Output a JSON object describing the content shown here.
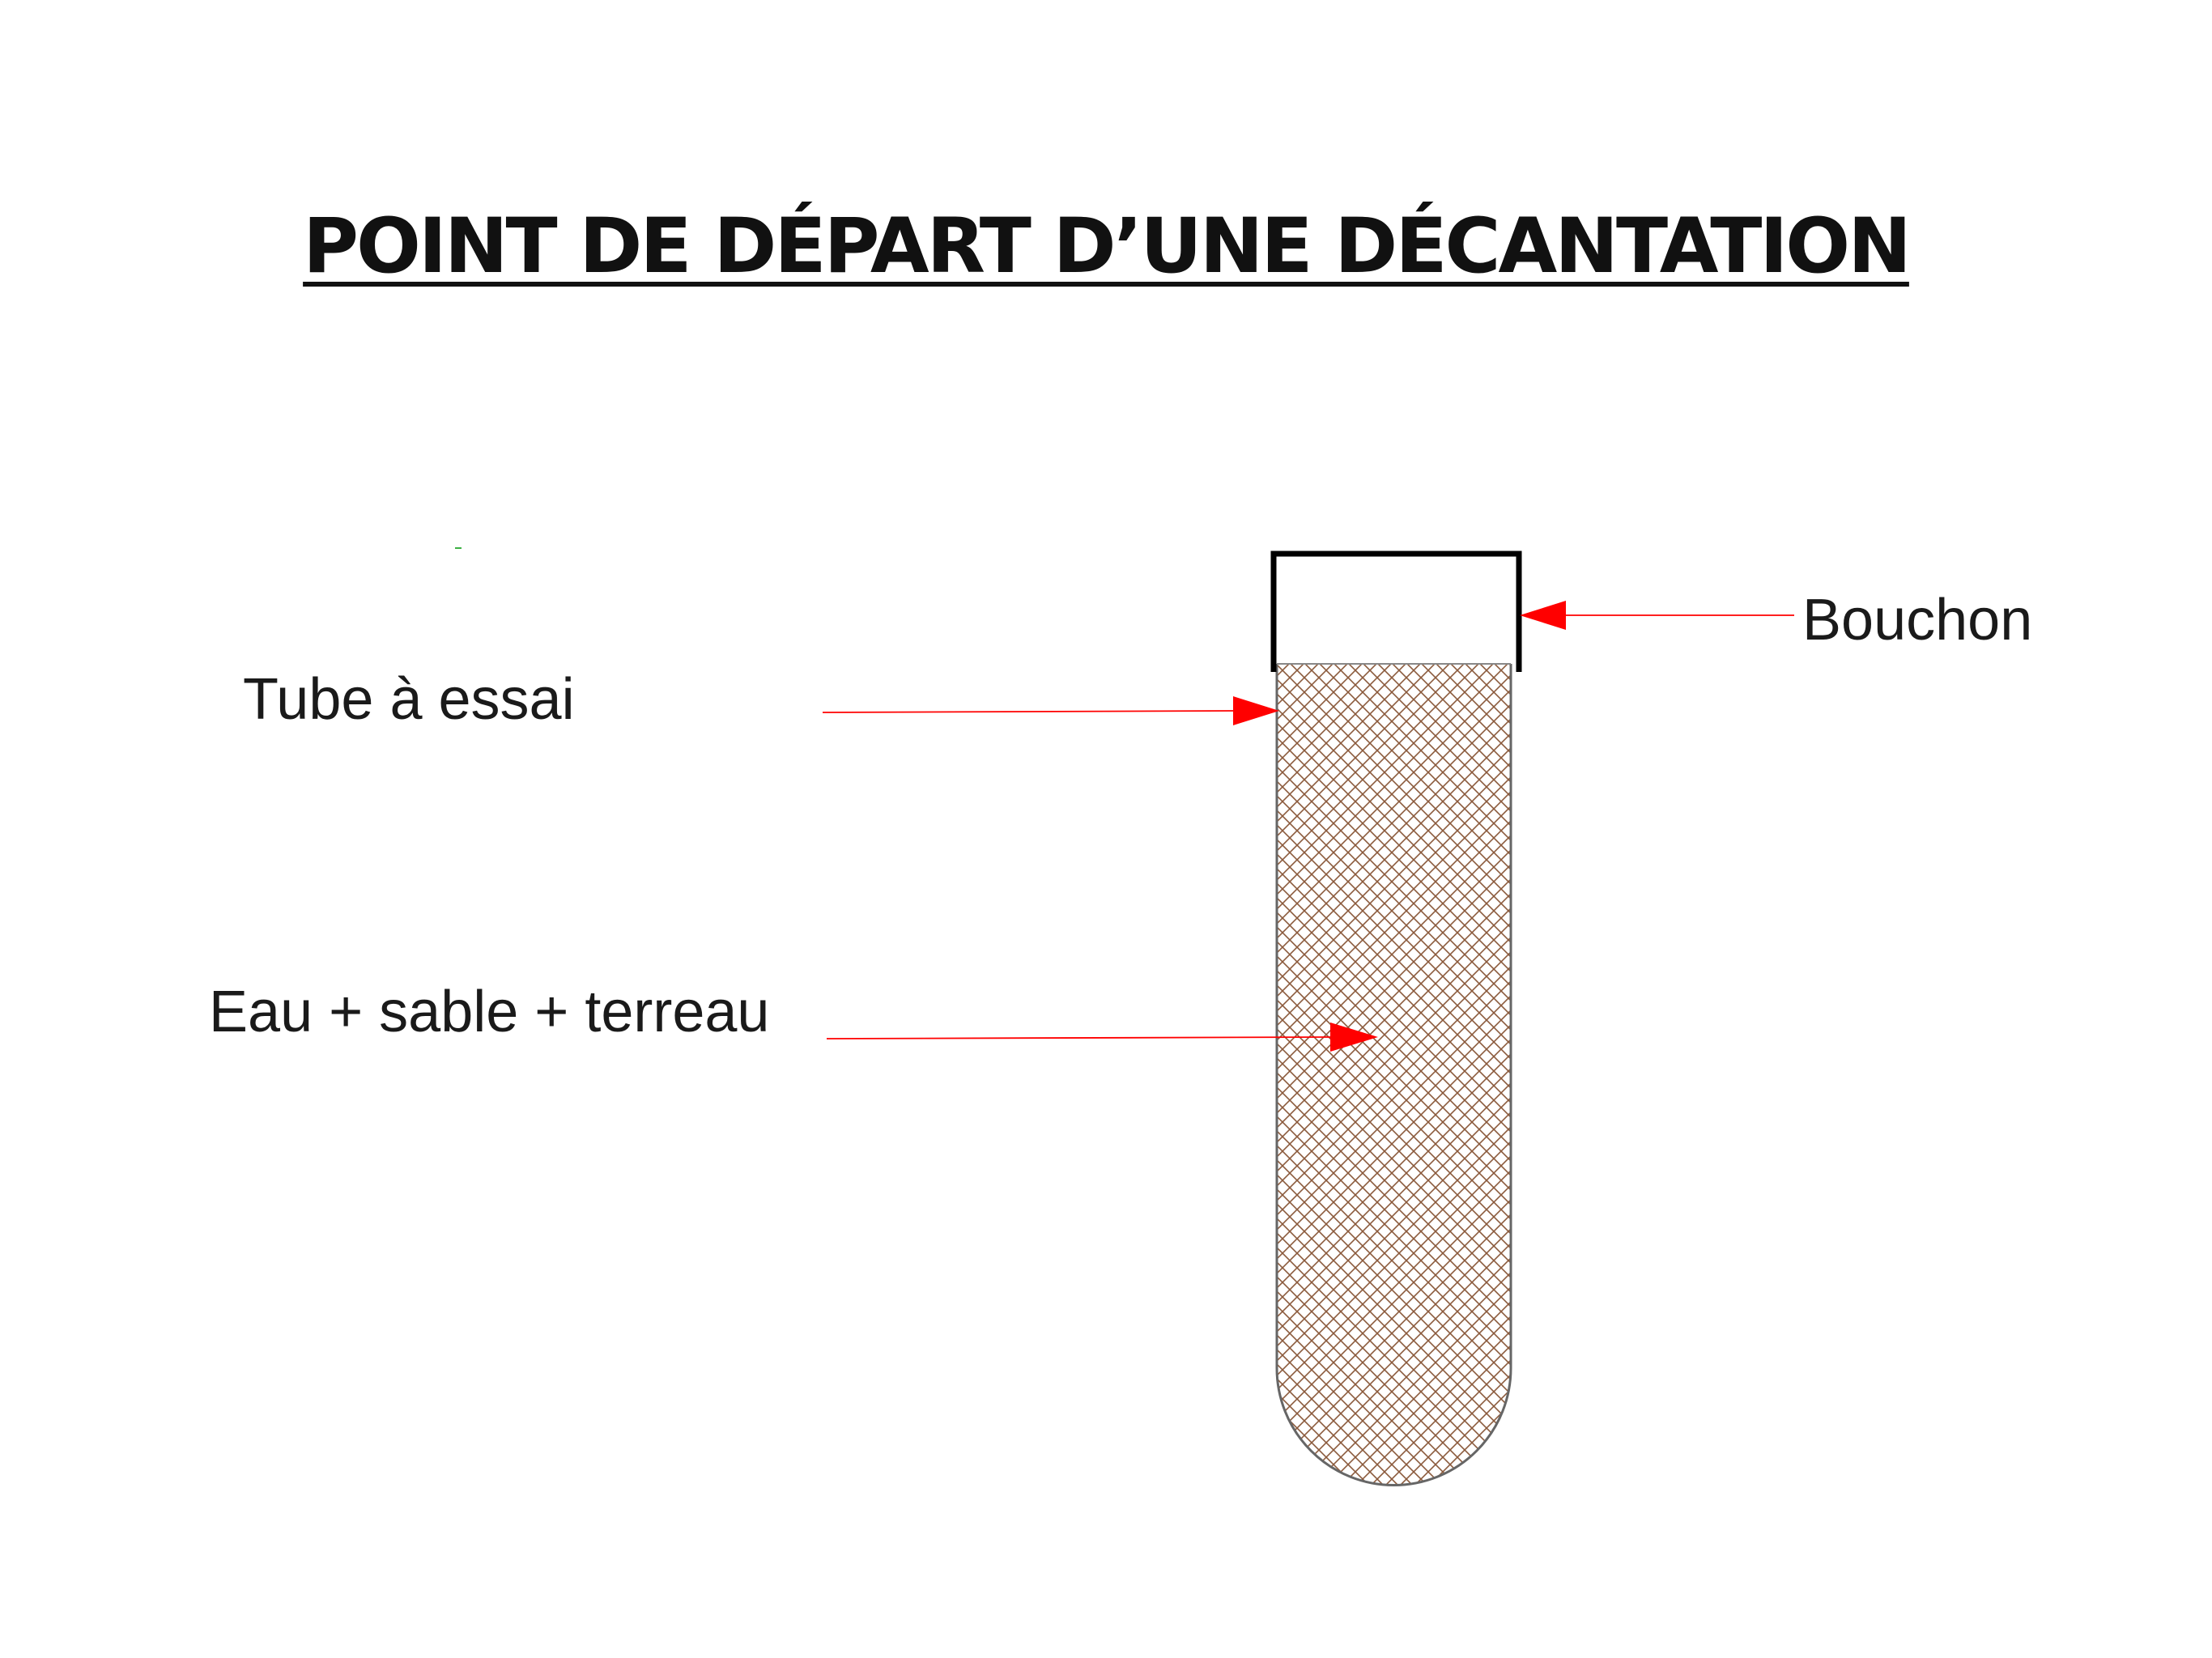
{
  "title": "POINT DE DÉPART D’UNE DÉCANTATION",
  "labels": {
    "tube": "Tube à essai",
    "mixture": "Eau + sable + terreau",
    "cap": "Bouchon"
  },
  "colors": {
    "arrow": "#ff0000",
    "hatch": "#8b5a3c",
    "outline": "#000000"
  }
}
